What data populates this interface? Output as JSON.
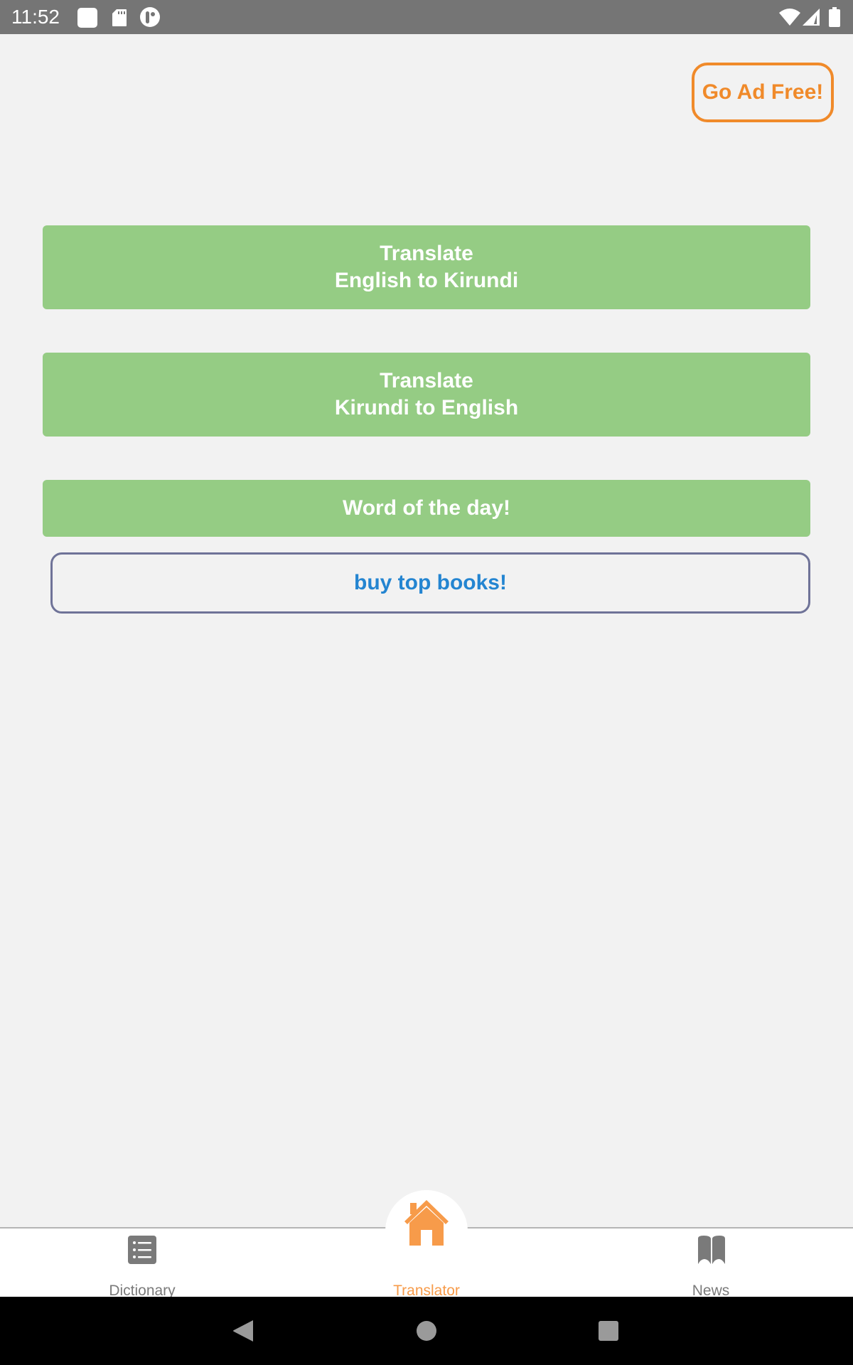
{
  "status_bar": {
    "time": "11:52",
    "left_icons": [
      "notification-square-icon",
      "sd-card-icon",
      "app-notification-icon"
    ],
    "right_icons": [
      "wifi-icon",
      "cell-signal-icon",
      "battery-icon"
    ]
  },
  "header": {
    "ad_free_label": "Go Ad Free!"
  },
  "main": {
    "buttons": [
      {
        "line1": "Translate",
        "line2": "English to Kirundi"
      },
      {
        "line1": "Translate",
        "line2": "Kirundi to English"
      },
      {
        "line1": "Word of the day!"
      }
    ],
    "books_label": "buy top books!"
  },
  "bottom_nav": {
    "items": [
      {
        "label": "Dictionary",
        "icon": "list-icon",
        "active": false
      },
      {
        "label": "Translator",
        "icon": "home-icon",
        "active": true
      },
      {
        "label": "News",
        "icon": "book-icon",
        "active": false
      }
    ]
  },
  "colors": {
    "accent_orange": "#f08a2a",
    "active_tab": "#f79b4a",
    "button_green": "#95cc84",
    "link_blue": "#2485d1",
    "outline_slate": "#6f7398"
  }
}
